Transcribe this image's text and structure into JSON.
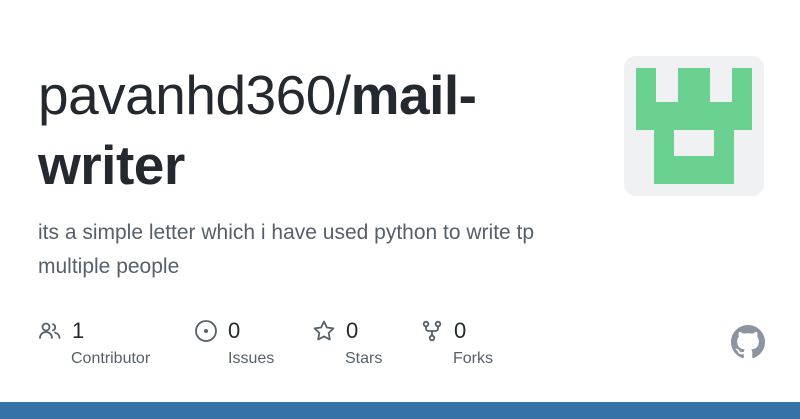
{
  "repo": {
    "owner": "pavanhd360/",
    "name_line1": "mail-",
    "name_line2": "writer",
    "description": "its a simple letter which i have used python to write tp multiple people"
  },
  "stats": [
    {
      "icon": "people-icon",
      "value": "1",
      "label": "Contributor"
    },
    {
      "icon": "issue-icon",
      "value": "0",
      "label": "Issues"
    },
    {
      "icon": "star-icon",
      "value": "0",
      "label": "Stars"
    },
    {
      "icon": "fork-icon",
      "value": "0",
      "label": "Forks"
    }
  ],
  "colors": {
    "avatar_green": "#6bd190",
    "avatar_bg": "#f0f1f2",
    "language_bar": "#3572a5",
    "text_primary": "#24292f",
    "text_secondary": "#57606a"
  },
  "icons": {
    "brand": "github-icon",
    "avatar": "identicon-avatar"
  }
}
